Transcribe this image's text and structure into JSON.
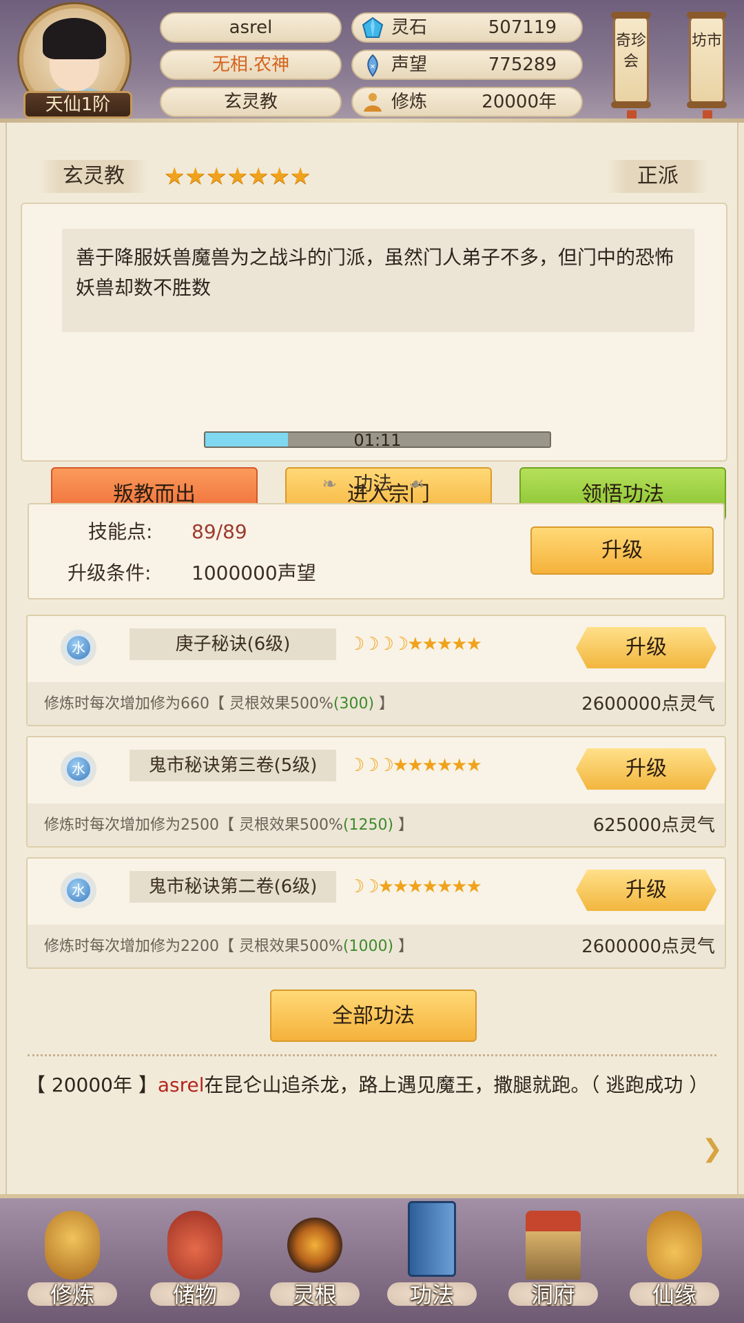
{
  "header": {
    "player_name": "asrel",
    "title": "无相.农神",
    "sect": "玄灵教",
    "rank": "天仙1阶",
    "stats": [
      {
        "icon": "spirit-stone-icon",
        "label": "灵石",
        "value": "507119"
      },
      {
        "icon": "prestige-icon",
        "label": "声望",
        "value": "775289"
      },
      {
        "icon": "cultivation-icon",
        "label": "修炼",
        "value": "20000年"
      }
    ],
    "scroll_buttons": [
      {
        "label": "奇珍会"
      },
      {
        "label": "坊市"
      }
    ]
  },
  "sect_info": {
    "name": "玄灵教",
    "stars": "★★★★★★★",
    "star_count": 7,
    "alignment": "正派",
    "description": "善于降服妖兽魔兽为之战斗的门派，虽然门人弟子不多，但门中的恐怖妖兽却数不胜数",
    "timer": "01:11",
    "timer_progress": 0.24,
    "actions": [
      {
        "label": "叛教而出"
      },
      {
        "label": "进入宗门"
      },
      {
        "label": "领悟功法"
      }
    ]
  },
  "gongfa": {
    "section_title": "功法",
    "skill_points_label": "技能点:",
    "skill_points_value": "89/89",
    "upgrade_cond_label": "升级条件:",
    "upgrade_cond_value": "1000000声望",
    "upgrade_label": "升级"
  },
  "techniques": [
    {
      "element": "水",
      "name": "庚子秘诀(6级)",
      "rating": "☽☽☽☽★★★★★",
      "upgrade_label": "升级",
      "effect_prefix": "修炼时每次增加修为660【 灵根效果500%",
      "effect_bonus": "(300)",
      "effect_suffix": " 】",
      "cost": "2600000点灵气"
    },
    {
      "element": "水",
      "name": "鬼市秘诀第三卷(5级)",
      "rating": "☽☽☽★★★★★★",
      "upgrade_label": "升级",
      "effect_prefix": "修炼时每次增加修为2500【 灵根效果500%",
      "effect_bonus": "(1250)",
      "effect_suffix": " 】",
      "cost": "625000点灵气"
    },
    {
      "element": "水",
      "name": "鬼市秘诀第二卷(6级)",
      "rating": "☽☽★★★★★★★",
      "upgrade_label": "升级",
      "effect_prefix": "修炼时每次增加修为2200【 灵根效果500%",
      "effect_bonus": "(1000)",
      "effect_suffix": " 】",
      "cost": "2600000点灵气"
    }
  ],
  "all_techniques_label": "全部功法",
  "log": {
    "prefix": "【 20000年 】",
    "name": "asrel",
    "text": "在昆仑山追杀龙，路上遇见魔王，撒腿就跑。（ 逃跑成功 ）"
  },
  "bottom_nav": [
    {
      "icon": "cultivation-monk-icon",
      "label": "修炼"
    },
    {
      "icon": "storage-bag-icon",
      "label": "储物"
    },
    {
      "icon": "spirit-root-icon",
      "label": "灵根"
    },
    {
      "icon": "technique-book-icon",
      "label": "功法"
    },
    {
      "icon": "cave-mansion-icon",
      "label": "洞府"
    },
    {
      "icon": "gourd-icon",
      "label": "仙缘"
    }
  ]
}
